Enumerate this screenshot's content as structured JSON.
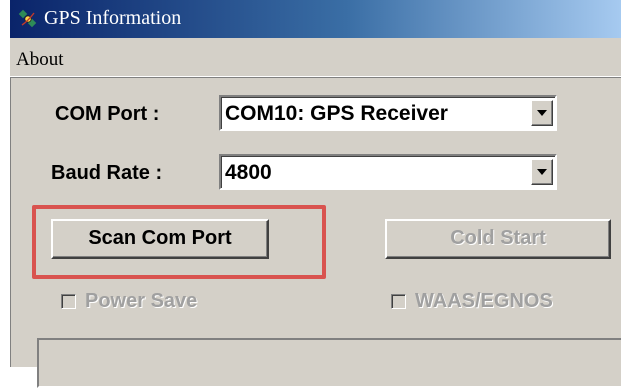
{
  "window": {
    "title": "GPS Information",
    "icon": "gps-satellite-icon"
  },
  "menu": {
    "items": [
      {
        "label": "About"
      }
    ]
  },
  "com_port": {
    "label": "COM Port :",
    "value": "COM10:  GPS Receiver"
  },
  "baud_rate": {
    "label": "Baud Rate :",
    "value": "4800"
  },
  "buttons": {
    "scan_label": "Scan Com Port",
    "cold_start_label": "Cold Start"
  },
  "options": {
    "power_save_label": "Power Save",
    "waas_label": "WAAS/EGNOS"
  },
  "colors": {
    "highlight": "#d9534f",
    "titlebar_start": "#0a246a",
    "titlebar_end": "#a6caf0",
    "face": "#d4d0c8",
    "disabled_text": "#a0a0a0"
  }
}
